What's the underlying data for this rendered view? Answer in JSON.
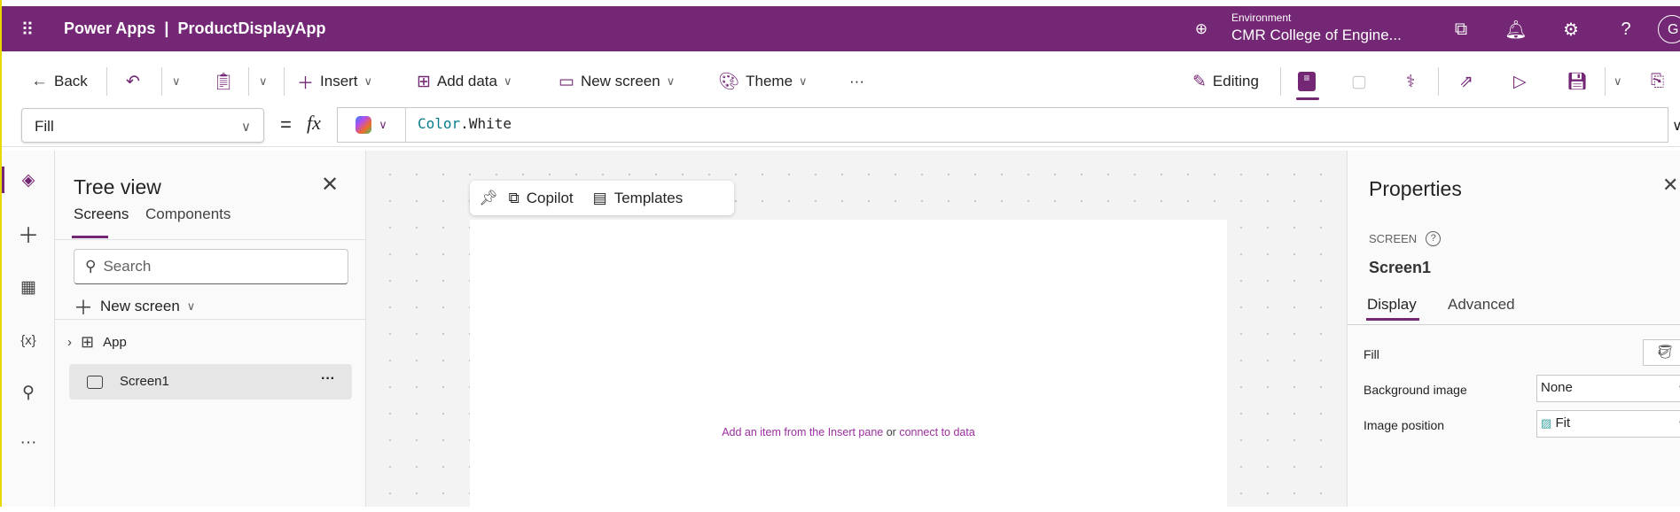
{
  "header": {
    "app_name": "Power Apps",
    "separator": "|",
    "app_title": "ProductDisplayApp",
    "environment_label": "Environment",
    "environment_name": "CMR College of Engine...",
    "avatar_initial": "G",
    "brand_color": "#742774"
  },
  "toolbar": {
    "back": "Back",
    "insert": "Insert",
    "add_data": "Add data",
    "new_screen": "New screen",
    "theme": "Theme",
    "more": "···",
    "editing": "Editing"
  },
  "formula": {
    "property": "Fill",
    "equals": "=",
    "fx": "fx",
    "expression_obj": "Color",
    "expression_dot": ".",
    "expression_member": "White"
  },
  "tree": {
    "title": "Tree view",
    "tabs": [
      "Screens",
      "Components"
    ],
    "search_placeholder": "Search",
    "new_screen": "New screen",
    "items": [
      {
        "label": "App"
      },
      {
        "label": "Screen1"
      }
    ],
    "more": "···"
  },
  "canvas": {
    "toolbar": {
      "copilot": "Copilot",
      "templates": "Templates"
    },
    "hint_link1": "Add an item from the Insert pane",
    "hint_or": "or",
    "hint_link2": "connect to data"
  },
  "properties": {
    "title": "Properties",
    "type": "SCREEN",
    "name": "Screen1",
    "tabs": [
      "Display",
      "Advanced"
    ],
    "rows": [
      {
        "label": "Fill"
      },
      {
        "label": "Background image",
        "value": "None"
      },
      {
        "label": "Image position",
        "value": "Fit"
      }
    ]
  }
}
